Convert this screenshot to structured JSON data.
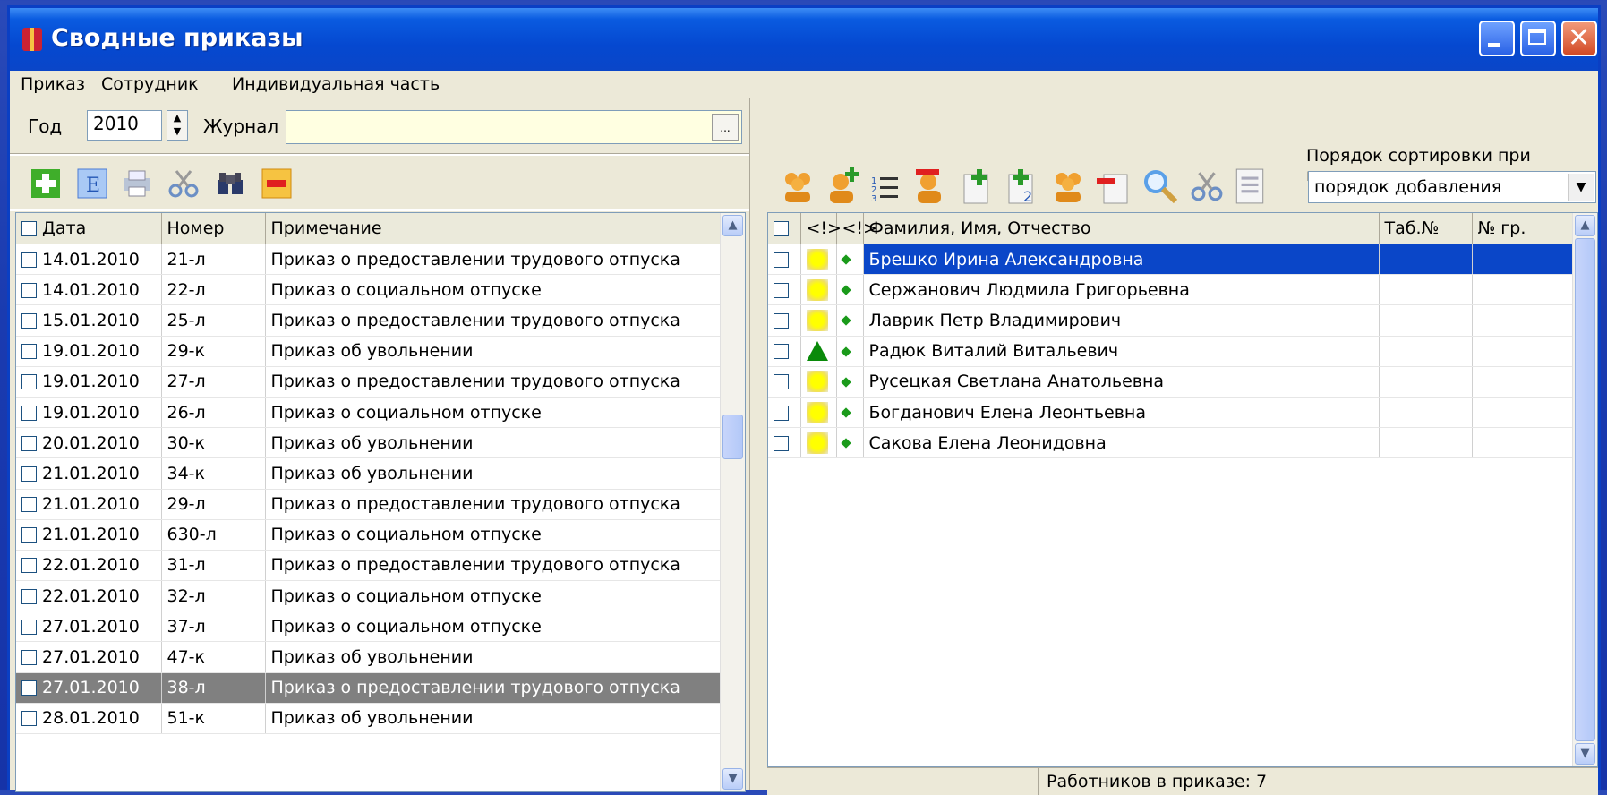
{
  "window": {
    "title": "Сводные приказы"
  },
  "menu": [
    "Приказ",
    "Сотрудник",
    "Индивидуальная часть"
  ],
  "filter": {
    "year_label": "Год",
    "year_value": "2010",
    "journal_label": "Журнал",
    "journal_value": "",
    "browse_label": "..."
  },
  "left_toolbar": [
    "add-icon",
    "edit-icon",
    "print-icon",
    "cut-icon",
    "find-icon",
    "remove-icon"
  ],
  "orders_table": {
    "columns": [
      "Дата",
      "Номер",
      "Примечание"
    ],
    "rows": [
      [
        "14.01.2010",
        "21-л",
        "Приказ о предоставлении трудового отпуска"
      ],
      [
        "14.01.2010",
        "22-л",
        "Приказ о социальном отпуске"
      ],
      [
        "15.01.2010",
        "25-л",
        "Приказ о предоставлении трудового отпуска"
      ],
      [
        "19.01.2010",
        "29-к",
        "Приказ об увольнении"
      ],
      [
        "19.01.2010",
        "27-л",
        "Приказ о предоставлении трудового отпуска"
      ],
      [
        "19.01.2010",
        "26-л",
        "Приказ о социальном отпуске"
      ],
      [
        "20.01.2010",
        "30-к",
        "Приказ об увольнении"
      ],
      [
        "21.01.2010",
        "34-к",
        "Приказ об увольнении"
      ],
      [
        "21.01.2010",
        "29-л",
        "Приказ о предоставлении трудового отпуска"
      ],
      [
        "21.01.2010",
        "630-л",
        "Приказ о социальном отпуске"
      ],
      [
        "22.01.2010",
        "31-л",
        "Приказ о предоставлении трудового отпуска"
      ],
      [
        "22.01.2010",
        "32-л",
        "Приказ о социальном отпуске"
      ],
      [
        "27.01.2010",
        "37-л",
        "Приказ о социальном отпуске"
      ],
      [
        "27.01.2010",
        "47-к",
        "Приказ об увольнении"
      ],
      [
        "27.01.2010",
        "38-л",
        "Приказ о предоставлении трудового отпуска"
      ],
      [
        "28.01.2010",
        "51-к",
        "Приказ об увольнении"
      ]
    ],
    "selected_index": 14
  },
  "right_toolbar": [
    "employees-icon",
    "add-employee-icon",
    "numbered-list-icon",
    "remove-employee-icon",
    "add-doc-icon",
    "add-doc-2-icon",
    "group-icon",
    "remove-doc-icon",
    "search-icon",
    "cut-icon",
    "report-icon"
  ],
  "sort": {
    "label": "Порядок сортировки при печати",
    "value": "порядок добавления"
  },
  "employees_table": {
    "columns": [
      "<!>",
      "<!>",
      "Фамилия, Имя, Отчество",
      "Таб.№",
      "№ гр."
    ],
    "rows": [
      {
        "icon": "sun",
        "name": "Брешко Ирина Александровна",
        "tab": "",
        "grp": ""
      },
      {
        "icon": "sun",
        "name": "Сержанович Людмила Григорьевна",
        "tab": "",
        "grp": ""
      },
      {
        "icon": "sun",
        "name": "Лаврик Петр Владимирович",
        "tab": "",
        "grp": ""
      },
      {
        "icon": "triangle",
        "name": "Радюк Виталий Витальевич",
        "tab": "",
        "grp": ""
      },
      {
        "icon": "sun",
        "name": "Русецкая Светлана Анатольевна",
        "tab": "",
        "grp": ""
      },
      {
        "icon": "sun",
        "name": "Богданович Елена Леонтьевна",
        "tab": "",
        "grp": ""
      },
      {
        "icon": "sun",
        "name": "Сакова Елена Леонидовна",
        "tab": "",
        "grp": ""
      }
    ],
    "selected_index": 0
  },
  "status": {
    "employees_count": "Работников в приказе: 7"
  }
}
